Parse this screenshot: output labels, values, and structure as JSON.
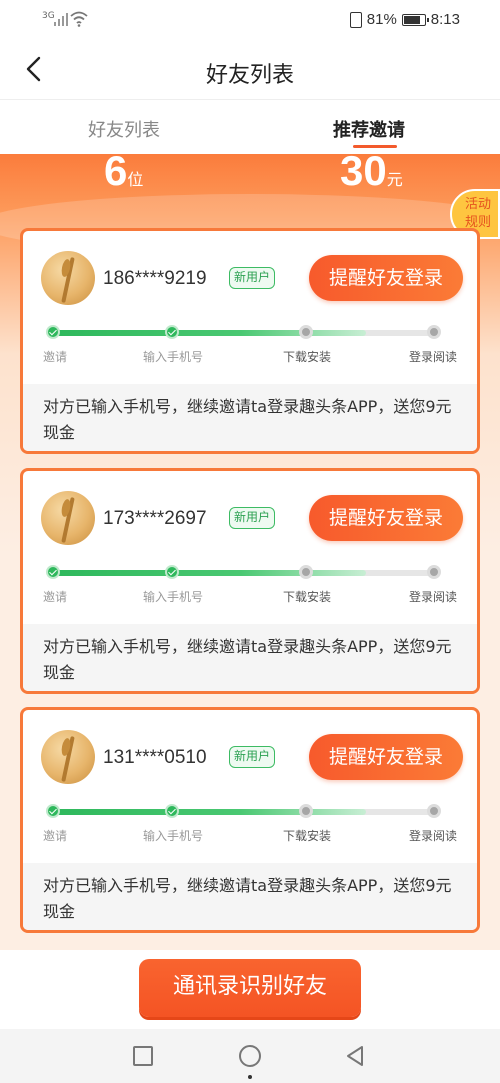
{
  "status_bar": {
    "signal_label": "3G",
    "battery": "81%",
    "time": "8:13"
  },
  "header": {
    "title": "好友列表"
  },
  "tabs": [
    {
      "label": "好友列表",
      "active": false
    },
    {
      "label": "推荐邀请",
      "active": true
    }
  ],
  "summary": {
    "invited_count": "6",
    "invited_unit": "位",
    "reward_amount": "30",
    "reward_unit": "元"
  },
  "activity_rules": {
    "line1": "活动",
    "line2": "规则"
  },
  "steps": [
    "邀请",
    "输入手机号",
    "下载安装",
    "登录阅读"
  ],
  "friends": [
    {
      "phone": "186****9219",
      "badge": "新用户",
      "remind_label": "提醒好友登录",
      "completed_steps": 2,
      "note": "对方已输入手机号，继续邀请ta登录趣头条APP，送您9元现金"
    },
    {
      "phone": "173****2697",
      "badge": "新用户",
      "remind_label": "提醒好友登录",
      "completed_steps": 2,
      "note": "对方已输入手机号，继续邀请ta登录趣头条APP，送您9元现金"
    },
    {
      "phone": "131****0510",
      "badge": "新用户",
      "remind_label": "提醒好友登录",
      "completed_steps": 2,
      "note": "对方已输入手机号，继续邀请ta登录趣头条APP，送您9元现金"
    }
  ],
  "bottom_button": {
    "label": "通讯录识别好友"
  },
  "colors": {
    "accent": "#f75a2c",
    "progress_done": "#2eb85c",
    "badge_green": "#3dbb63",
    "rules_yellow": "#fec540"
  },
  "icons": {
    "back": "chevron-left-icon",
    "recent_apps": "square-icon",
    "home": "circle-icon",
    "nav_back": "triangle-left-icon"
  }
}
